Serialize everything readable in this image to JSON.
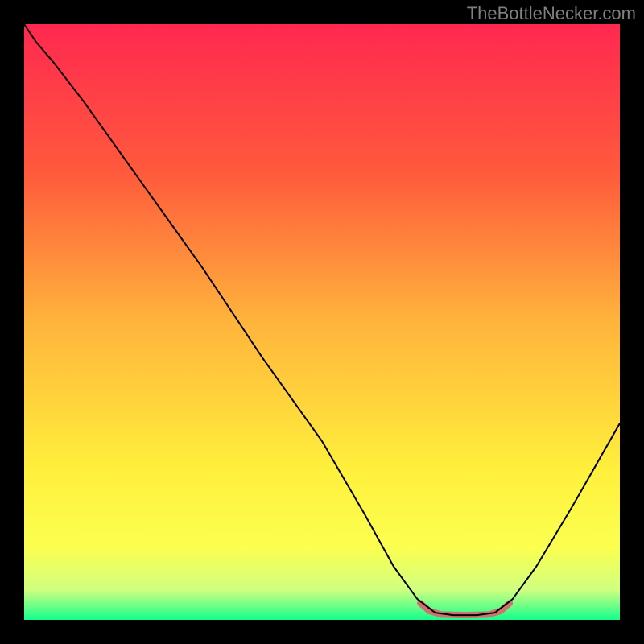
{
  "watermark": "TheBottleNecker.com",
  "chart_data": {
    "type": "line",
    "title": "",
    "xlabel": "",
    "ylabel": "",
    "x_range": [
      0,
      100
    ],
    "y_range": [
      0,
      100
    ],
    "gradient_stops": [
      {
        "offset": 0,
        "color": "#ff2850"
      },
      {
        "offset": 25,
        "color": "#ff5a3c"
      },
      {
        "offset": 50,
        "color": "#ffb43c"
      },
      {
        "offset": 75,
        "color": "#fff03c"
      },
      {
        "offset": 88,
        "color": "#fbff50"
      },
      {
        "offset": 95,
        "color": "#d0ff80"
      },
      {
        "offset": 100,
        "color": "#14ff8c"
      }
    ],
    "series": [
      {
        "name": "bottleneck-curve",
        "color": "#000000",
        "stroke_width": 2,
        "points": [
          {
            "x": 0,
            "y": 100
          },
          {
            "x": 2,
            "y": 97
          },
          {
            "x": 5,
            "y": 93.5
          },
          {
            "x": 10,
            "y": 87
          },
          {
            "x": 20,
            "y": 73
          },
          {
            "x": 30,
            "y": 59
          },
          {
            "x": 40,
            "y": 44
          },
          {
            "x": 50,
            "y": 30
          },
          {
            "x": 57,
            "y": 18
          },
          {
            "x": 62,
            "y": 9
          },
          {
            "x": 66,
            "y": 3.5
          },
          {
            "x": 69,
            "y": 1.2
          },
          {
            "x": 72,
            "y": 0.8
          },
          {
            "x": 76,
            "y": 0.8
          },
          {
            "x": 79,
            "y": 1.2
          },
          {
            "x": 82,
            "y": 3.5
          },
          {
            "x": 86,
            "y": 9
          },
          {
            "x": 92,
            "y": 19
          },
          {
            "x": 100,
            "y": 33
          }
        ]
      },
      {
        "name": "bottom-highlight",
        "color": "#d1716f",
        "stroke_width": 8,
        "points": [
          {
            "x": 66.5,
            "y": 2.8
          },
          {
            "x": 68,
            "y": 1.5
          },
          {
            "x": 70,
            "y": 0.9
          },
          {
            "x": 74,
            "y": 0.8
          },
          {
            "x": 78,
            "y": 0.9
          },
          {
            "x": 80,
            "y": 1.5
          },
          {
            "x": 81.5,
            "y": 2.8
          }
        ]
      }
    ]
  }
}
